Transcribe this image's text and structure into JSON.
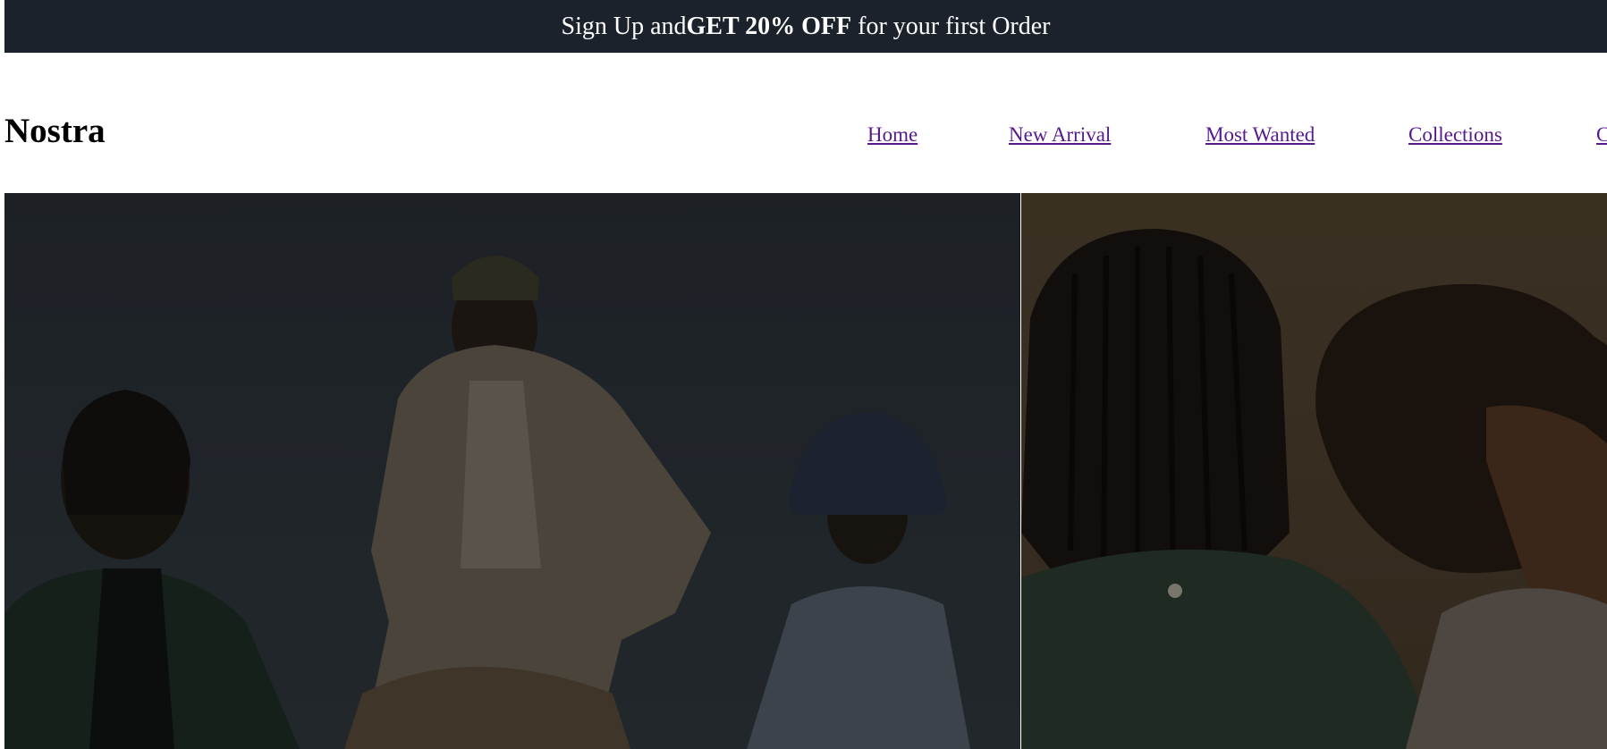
{
  "promo": {
    "text_before": "Sign Up and",
    "text_bold": "GET 20% OFF",
    "text_after": " for your first Order"
  },
  "header": {
    "logo": "Nostra",
    "nav": [
      {
        "label": "Home"
      },
      {
        "label": "New Arrival"
      },
      {
        "label": "Most Wanted"
      },
      {
        "label": "Collections"
      },
      {
        "label": "C"
      }
    ]
  },
  "colors": {
    "promo_background": "#1c222b",
    "link": "#551a8b",
    "hero_left_background": "#1f2429",
    "hero_right_background": "#372d21"
  }
}
